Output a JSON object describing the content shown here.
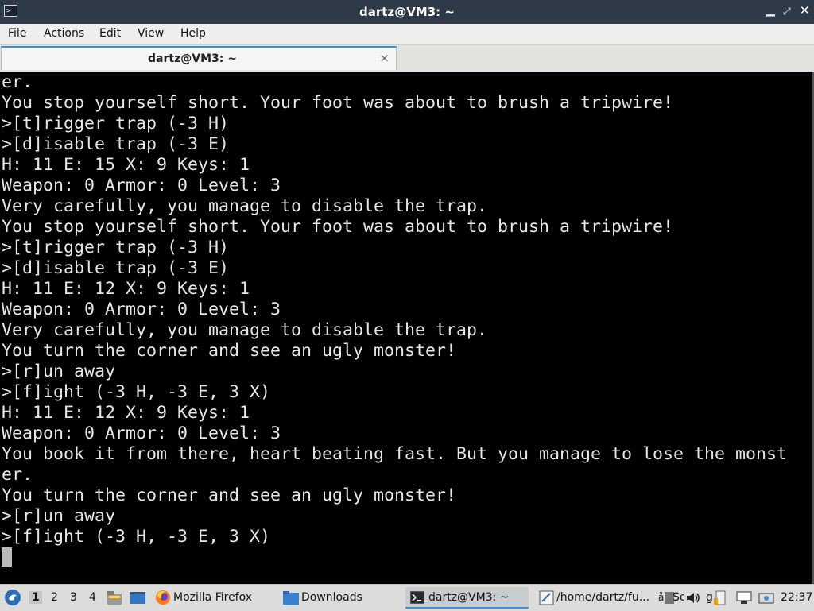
{
  "window": {
    "title": "dartz@VM3: ~"
  },
  "menu": [
    "File",
    "Actions",
    "Edit",
    "View",
    "Help"
  ],
  "tab": {
    "label": "dartz@VM3: ~",
    "close_icon": "×"
  },
  "terminal_lines": [
    "er.",
    "You stop yourself short. Your foot was about to brush a tripwire!",
    ">[t]rigger trap (-3 H)",
    ">[d]isable trap (-3 E)",
    "H: 11 E: 15 X: 9 Keys: 1",
    "Weapon: 0 Armor: 0 Level: 3",
    "Very carefully, you manage to disable the trap.",
    "You stop yourself short. Your foot was about to brush a tripwire!",
    ">[t]rigger trap (-3 H)",
    ">[d]isable trap (-3 E)",
    "H: 11 E: 12 X: 9 Keys: 1",
    "Weapon: 0 Armor: 0 Level: 3",
    "Very carefully, you manage to disable the trap.",
    "You turn the corner and see an ugly monster!",
    ">[r]un away",
    ">[f]ight (-3 H, -3 E, 3 X)",
    "H: 11 E: 12 X: 9 Keys: 1",
    "Weapon: 0 Armor: 0 Level: 3",
    "You book it from there, heart beating fast. But you manage to lose the monst",
    "er.",
    "You turn the corner and see an ugly monster!",
    ">[r]un away",
    ">[f]ight (-3 H, -3 E, 3 X)"
  ],
  "taskbar": {
    "workspaces": [
      "1",
      "2",
      "3",
      "4"
    ],
    "tasks": {
      "firefox": "Mozilla Firefox",
      "downloads": "Downloads",
      "terminal": "dartz@VM3: ~",
      "editor": "/home/dartz/fu...",
      "settings": "Se",
      "gt": "g"
    },
    "clock": "22:37"
  },
  "colors": {
    "terminal_bg": "#000000",
    "terminal_fg": "#e6e6e6",
    "titlebar_bg": "#2e3a48",
    "accent": "#3b8fd6"
  }
}
